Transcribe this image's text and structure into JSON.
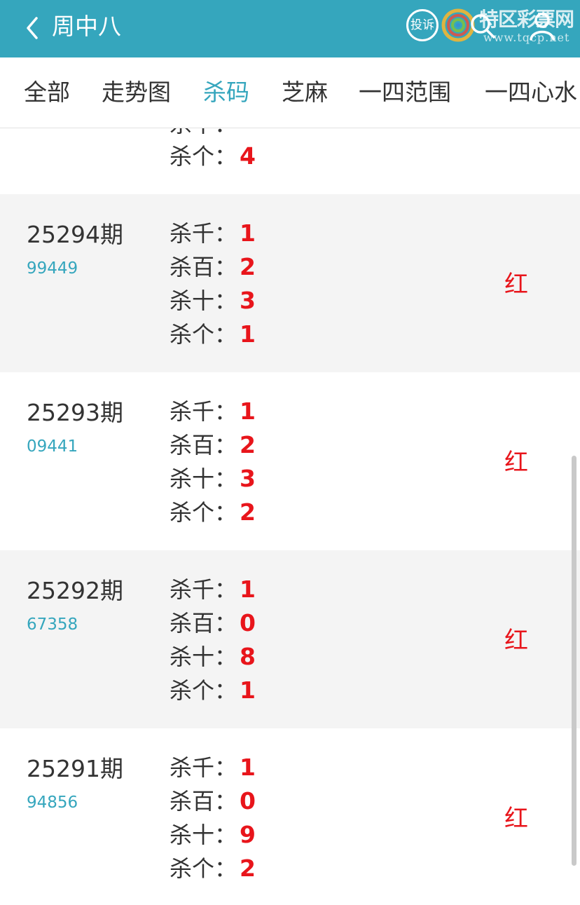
{
  "header": {
    "title": "周中八",
    "complain_label": "投诉",
    "watermark_title": "特区彩票网",
    "watermark_url": "www.tqcp.net"
  },
  "tabs": [
    {
      "label": "全部",
      "active": false
    },
    {
      "label": "走势图",
      "active": false
    },
    {
      "label": "杀码",
      "active": true
    },
    {
      "label": "芝麻",
      "active": false
    },
    {
      "label": "一四范围",
      "active": false
    },
    {
      "label": "一四心水",
      "active": false
    }
  ],
  "partial_record": {
    "kills": [
      {
        "label": "杀十：",
        "value": ""
      },
      {
        "label": "杀个：",
        "value": "4"
      }
    ]
  },
  "records": [
    {
      "issue": "25294期",
      "draw": "99449",
      "kills": [
        {
          "label": "杀千：",
          "value": "1"
        },
        {
          "label": "杀百：",
          "value": "2"
        },
        {
          "label": "杀十：",
          "value": "3"
        },
        {
          "label": "杀个：",
          "value": "1"
        }
      ],
      "result": "红"
    },
    {
      "issue": "25293期",
      "draw": "09441",
      "kills": [
        {
          "label": "杀千：",
          "value": "1"
        },
        {
          "label": "杀百：",
          "value": "2"
        },
        {
          "label": "杀十：",
          "value": "3"
        },
        {
          "label": "杀个：",
          "value": "2"
        }
      ],
      "result": "红"
    },
    {
      "issue": "25292期",
      "draw": "67358",
      "kills": [
        {
          "label": "杀千：",
          "value": "1"
        },
        {
          "label": "杀百：",
          "value": "0"
        },
        {
          "label": "杀十：",
          "value": "8"
        },
        {
          "label": "杀个：",
          "value": "1"
        }
      ],
      "result": "红"
    },
    {
      "issue": "25291期",
      "draw": "94856",
      "kills": [
        {
          "label": "杀千：",
          "value": "1"
        },
        {
          "label": "杀百：",
          "value": "0"
        },
        {
          "label": "杀十：",
          "value": "9"
        },
        {
          "label": "杀个：",
          "value": "2"
        }
      ],
      "result": "红"
    }
  ],
  "colors": {
    "accent": "#35a6bd",
    "highlight_red": "#e8151b",
    "row_alt": "#f4f4f4"
  },
  "icons": {
    "back": "chevron-left-icon",
    "search": "search-icon",
    "user": "user-icon",
    "logo": "swirl-logo-icon"
  }
}
